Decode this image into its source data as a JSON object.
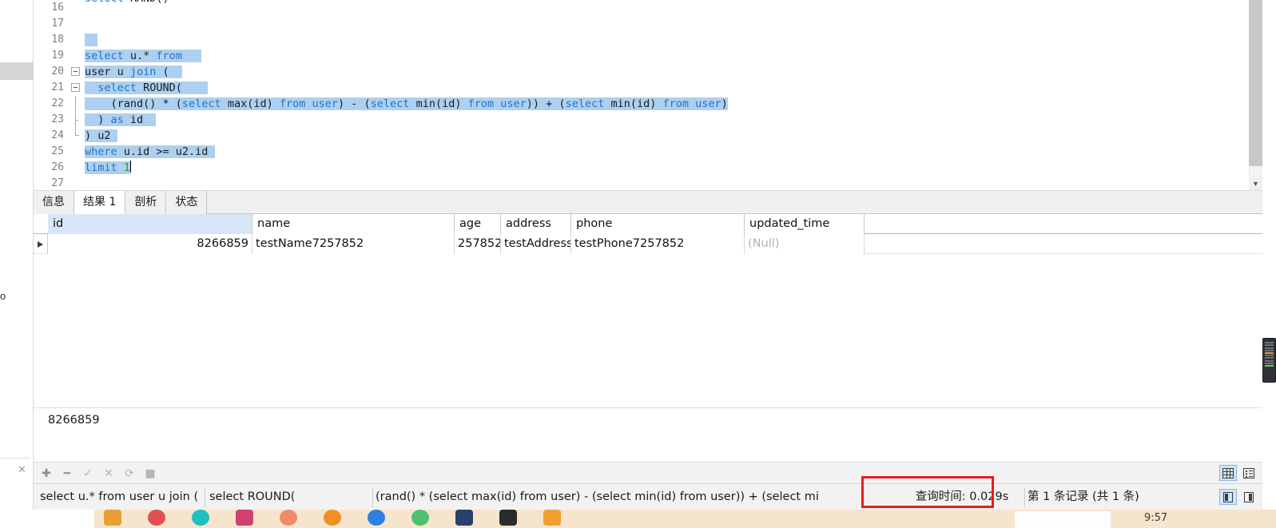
{
  "app": {
    "name": "navicat-query-editor"
  },
  "editor": {
    "lines": [
      {
        "no": "16",
        "text": "select RAND()",
        "partial": true
      },
      {
        "no": "17",
        "text": ""
      },
      {
        "no": "18",
        "text": ""
      },
      {
        "no": "19",
        "text": "select u.* from"
      },
      {
        "no": "20",
        "text": "user u join ("
      },
      {
        "no": "21",
        "text": "  select ROUND("
      },
      {
        "no": "22",
        "text": "    (rand() * (select max(id) from user) - (select min(id) from user)) + (select min(id) from user)"
      },
      {
        "no": "23",
        "text": "  ) as id"
      },
      {
        "no": "24",
        "text": ") u2"
      },
      {
        "no": "25",
        "text": "where u.id >= u2.id"
      },
      {
        "no": "26",
        "text": "limit 1"
      },
      {
        "no": "27",
        "text": ""
      }
    ],
    "scrollbar": {
      "down_arrow": "chevron-down-icon"
    }
  },
  "tabs": [
    {
      "label": "信息",
      "active": false
    },
    {
      "label": "结果 1",
      "active": true
    },
    {
      "label": "剖析",
      "active": false
    },
    {
      "label": "状态",
      "active": false
    }
  ],
  "result_grid": {
    "columns": [
      "id",
      "name",
      "age",
      "address",
      "phone",
      "updated_time"
    ],
    "rows": [
      {
        "id": "8266859",
        "name": "testName7257852",
        "age": "257852",
        "address": "testAddress",
        "phone": "testPhone7257852",
        "updated_time": "(Null)"
      }
    ],
    "selected_cell_value": "8266859"
  },
  "bottom_toolbar": {
    "icons": [
      {
        "name": "add-record-icon",
        "glyph": "✚"
      },
      {
        "name": "delete-record-icon",
        "glyph": "━"
      },
      {
        "name": "apply-changes-icon",
        "glyph": "✓"
      },
      {
        "name": "cancel-changes-icon",
        "glyph": "✕"
      },
      {
        "name": "refresh-icon",
        "glyph": "⟳"
      },
      {
        "name": "stop-icon",
        "glyph": "■"
      }
    ],
    "view_buttons": [
      {
        "name": "grid-view-icon",
        "active": true
      },
      {
        "name": "form-view-icon",
        "active": false
      }
    ]
  },
  "status_bar": {
    "sql_segments": [
      "select u.* from  user u join (",
      "select ROUND(",
      "(rand() * (select max(id) from user) - (select min(id) from user)) + (select mi"
    ],
    "query_time": "查询时间: 0.029s",
    "record_count": "第 1 条记录  (共 1 条)",
    "panel_buttons": [
      {
        "name": "left-panel-toggle-icon",
        "active": true
      },
      {
        "name": "right-panel-toggle-icon",
        "active": false
      }
    ]
  },
  "annotation": {
    "highlight_color": "#ec1c1c",
    "highlight_target": "查询时间: 0.029s"
  },
  "taskbar": {
    "clock": "9:57",
    "apps": [
      {
        "name": "taskbar-app-1",
        "color": "#e8a033"
      },
      {
        "name": "taskbar-app-2",
        "color": "#e05050"
      },
      {
        "name": "taskbar-app-3",
        "color": "#1fc0c0"
      },
      {
        "name": "taskbar-app-4",
        "color": "#d04070"
      },
      {
        "name": "taskbar-app-5",
        "color": "#f08a6a"
      },
      {
        "name": "taskbar-app-6",
        "color": "#f09020"
      },
      {
        "name": "taskbar-app-7",
        "color": "#2f80e0"
      },
      {
        "name": "taskbar-app-8",
        "color": "#4fc070"
      },
      {
        "name": "taskbar-app-9",
        "color": "#2a3f6e"
      },
      {
        "name": "taskbar-app-10",
        "color": "#2b2b2b"
      },
      {
        "name": "taskbar-app-11",
        "color": "#f0a030"
      }
    ]
  },
  "background_window": {
    "stray_char": "o",
    "close_glyph": "✕"
  },
  "theme": {
    "selection": "#aed0f0",
    "keyword": "#2273c6",
    "number": "#1fa81f",
    "accent": "#cfe4f7"
  }
}
